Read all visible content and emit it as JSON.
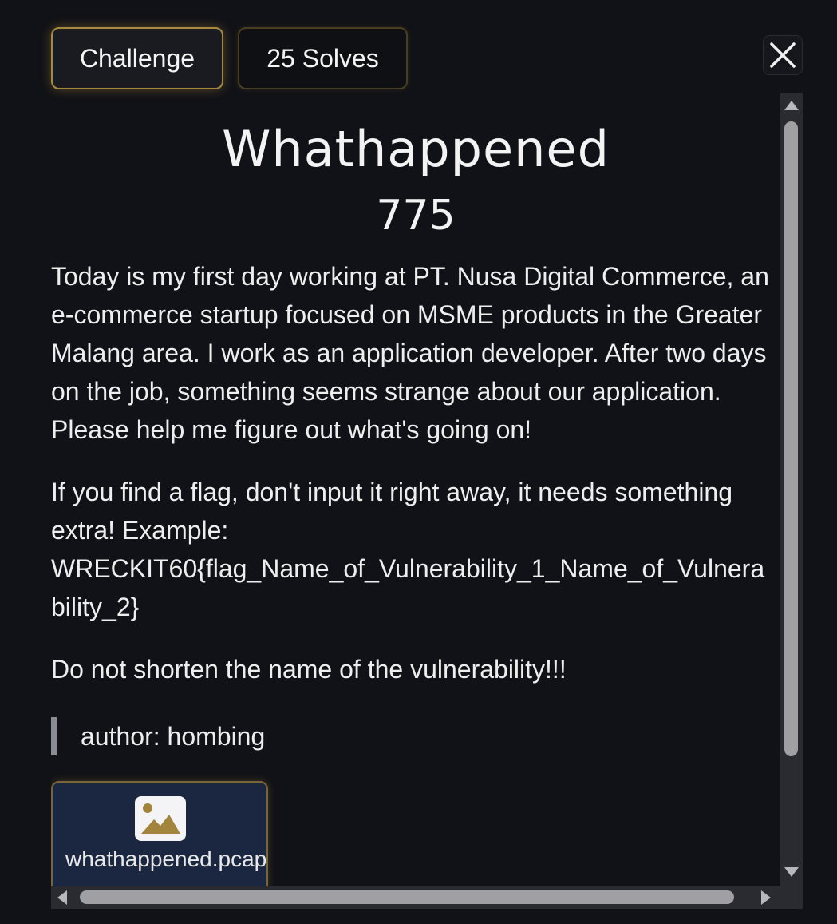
{
  "tabs": {
    "challenge_label": "Challenge",
    "solves_label": "25 Solves"
  },
  "challenge": {
    "title": "Whathappened",
    "points": "775",
    "description": [
      "Today is my first day working at PT. Nusa Digital Commerce, an e-commerce startup focused on MSME products in the Greater Malang area. I work as an application developer. After two days on the job, something seems strange about our application. Please help me figure out what's going on!",
      "If you find a flag, don't input it right away, it needs something extra! Example:",
      "WRECKIT60{flag_Name_of_Vulnerability_1_Name_of_Vulnerability_2}",
      "Do not shorten the name of the vulnerability!!!"
    ],
    "author": "author: hombing"
  },
  "attachment": {
    "file_name": "whathappened.pcap",
    "icon": "image-icon"
  },
  "colors": {
    "background": "#111217",
    "accent_gold": "#d6aa46",
    "file_card_bg": "#1b2741"
  }
}
